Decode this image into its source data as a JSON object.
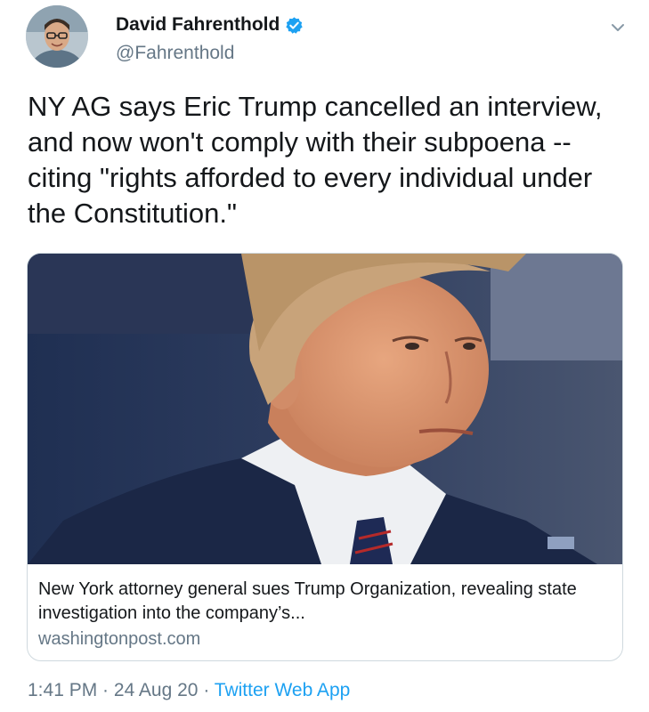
{
  "author": {
    "display_name": "David Fahrenthold",
    "handle": "@Fahrenthold",
    "verified": true
  },
  "tweet": {
    "text": "NY AG says Eric Trump cancelled an interview, and now won't comply with their subpoena -- citing \"rights afforded to every individual under the Constitution.\""
  },
  "card": {
    "title": "New York attorney general sues Trump Organization, revealing state investigation into the company’s...",
    "domain": "washingtonpost.com"
  },
  "meta": {
    "time": "1:41 PM",
    "separator": " · ",
    "date": "24 Aug 20",
    "app": "Twitter Web App"
  },
  "colors": {
    "accent": "#1da1f2",
    "secondary_text": "#657786",
    "border": "#cfd9de"
  },
  "icons": {
    "verified": "verified-badge-icon",
    "more": "chevron-down-icon"
  }
}
